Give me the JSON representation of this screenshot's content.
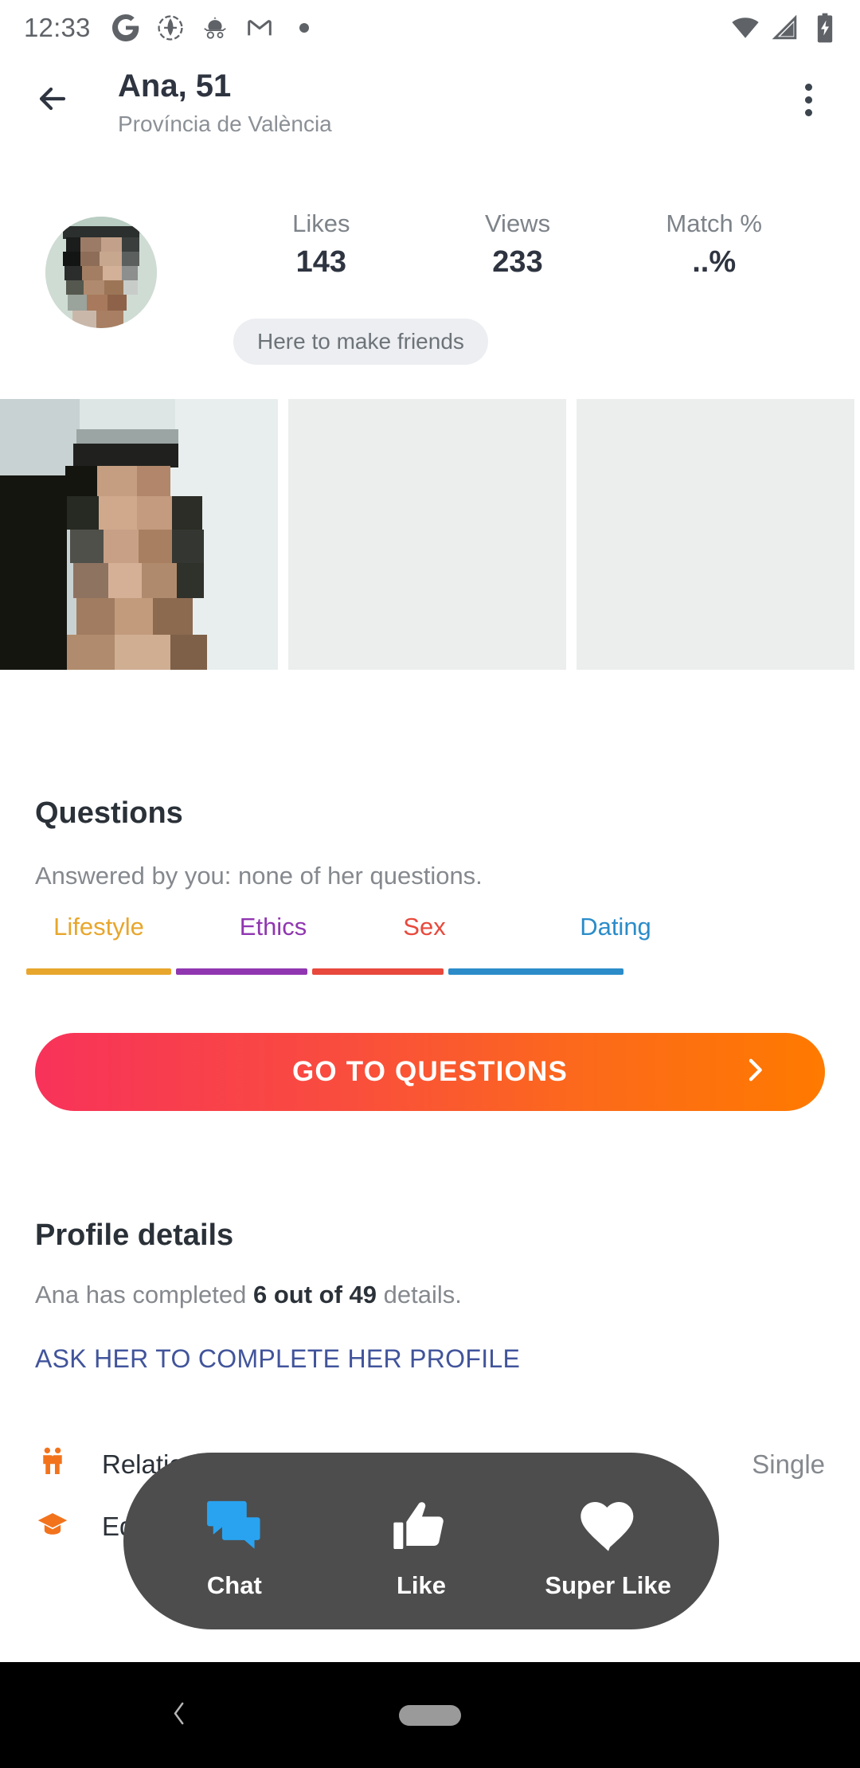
{
  "status_bar": {
    "time": "12:33",
    "left_icons": [
      "google-icon",
      "app-badge-icon",
      "carriage-icon",
      "gmail-icon",
      "dot-icon"
    ],
    "right_icons": [
      "wifi-icon",
      "cellular-signal-icon",
      "battery-charging-icon"
    ]
  },
  "header": {
    "back": "back-arrow-icon",
    "title": "Ana, 51",
    "subtitle": "Província de València",
    "overflow": "more-options-icon"
  },
  "stats": [
    {
      "label": "Likes",
      "value": "143"
    },
    {
      "label": "Views",
      "value": "233"
    },
    {
      "label": "Match %",
      "value": "..%"
    }
  ],
  "intent_badge": "Here to make friends",
  "gallery": {
    "tiles": [
      "photo-1",
      "photo-placeholder-2",
      "photo-placeholder-3"
    ]
  },
  "questions": {
    "title": "Questions",
    "subtitle": "Answered by you: none of her questions.",
    "tabs": [
      {
        "label": "Lifestyle",
        "color": "#E8A62C"
      },
      {
        "label": "Ethics",
        "color": "#9036B0"
      },
      {
        "label": "Sex",
        "color": "#E8493C"
      },
      {
        "label": "Dating",
        "color": "#2B8CC9"
      }
    ],
    "cta_label": "GO TO QUESTIONS",
    "cta_chevron": "chevron-right-icon",
    "cta_gradient_from": "#F8325A",
    "cta_gradient_to": "#FF7A00"
  },
  "profile_details": {
    "title": "Profile details",
    "line_prefix": "Ana has completed ",
    "line_strong": "6 out of 49",
    "line_suffix": " details.",
    "ask_link": "ASK HER TO COMPLETE HER PROFILE",
    "ask_link_color": "#41549B",
    "rows": [
      {
        "icon": "couple-icon",
        "label": "Relationship status",
        "value": "Single",
        "icon_color": "#F2731C"
      },
      {
        "icon": "graduation-cap-icon",
        "label": "Education",
        "value": "",
        "icon_color": "#F2731C"
      }
    ]
  },
  "action_bar": {
    "background": "#4D4D4D",
    "items": [
      {
        "icon": "chat-bubbles-icon",
        "label": "Chat",
        "color": "#29A3F0"
      },
      {
        "icon": "thumbs-up-icon",
        "label": "Like",
        "color": "#FFFFFF"
      },
      {
        "icon": "heart-icon",
        "label": "Super Like",
        "color": "#FFFFFF"
      }
    ]
  },
  "nav_bar": {
    "back": "nav-back-icon",
    "home": "nav-home-pill"
  }
}
